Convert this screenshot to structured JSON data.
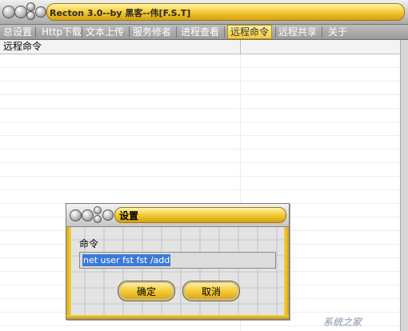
{
  "window": {
    "title": "Recton 3.0--by 黑客--伟[F.S.T]"
  },
  "menu": {
    "items": [
      {
        "label": "总设置"
      },
      {
        "label": "Http下载"
      },
      {
        "label": "文本上传"
      },
      {
        "label": "服务修者"
      },
      {
        "label": "进程查看"
      },
      {
        "label": "远程命令",
        "active": true
      },
      {
        "label": "远程共享"
      },
      {
        "label": "关于"
      }
    ]
  },
  "list": {
    "columns": [
      "远程命令",
      ""
    ]
  },
  "dialog": {
    "title": "设置",
    "command_label": "命令",
    "command_value": "net user fst fst /add",
    "ok_label": "确定",
    "cancel_label": "取消"
  },
  "watermark": "系统之家",
  "colors": {
    "accent_gold": "#f5cf3d",
    "selection": "#3b7bd8",
    "menubar": "#9a9a9a"
  }
}
